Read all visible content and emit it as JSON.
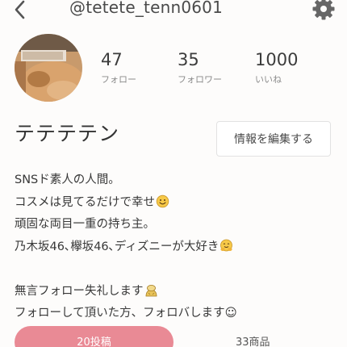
{
  "header": {
    "back_icon": "chevron-left-icon",
    "username": "@tetete_tenn0601",
    "settings_icon": "gear-icon"
  },
  "profile": {
    "avatar_icon": "avatar-photo",
    "stats": [
      {
        "value": "47",
        "label": "フォロー"
      },
      {
        "value": "35",
        "label": "フォロワー"
      },
      {
        "value": "1000",
        "label": "いいね"
      }
    ],
    "display_name": "テテテテン",
    "edit_button_label": "情報を編集する"
  },
  "bio": {
    "lines": [
      "SNSド素人の人間。",
      "コスメは見てるだけで幸せ",
      "頑固な両目一重の持ち主。",
      "乃木坂46､欅坂46､ディズニーが大好き",
      "無言フォロー失礼します",
      "フォローして頂いた方、フォロバします☺"
    ],
    "emojis": {
      "line2": "smiling-face-icon",
      "line4": "hugging-face-icon",
      "line5": "bowing-person-icon"
    }
  },
  "tabs": {
    "posts_label": "20投稿",
    "items_label": "33商品"
  },
  "colors": {
    "accent": "#e98a95",
    "background": "#fdfcfb",
    "emoji_yellow": "#f7c948"
  }
}
